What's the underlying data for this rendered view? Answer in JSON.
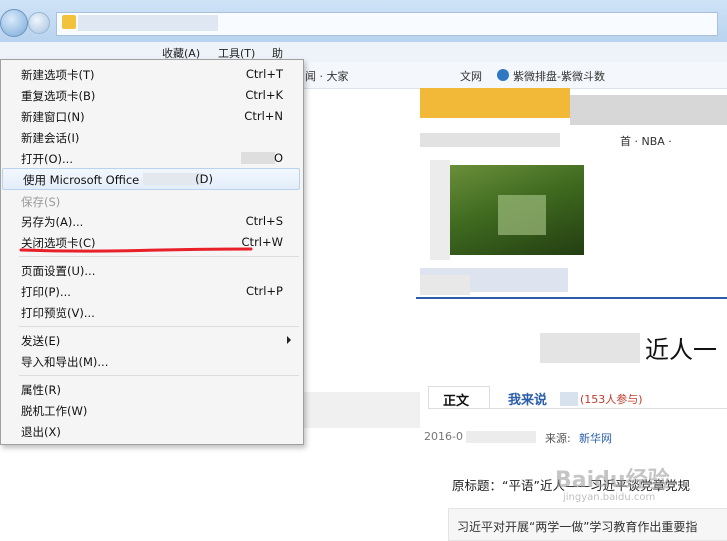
{
  "menubar": {
    "items": [
      "收藏(A)",
      "工具(T)",
      "助"
    ]
  },
  "favbar": {
    "items": [
      "闻 · 大家",
      "文网",
      "紫微排盘-紫微斗数"
    ]
  },
  "menu": {
    "items": [
      {
        "label": "新建选项卡(T)",
        "shortcut": "Ctrl+T"
      },
      {
        "label": "重复选项卡(B)",
        "shortcut": "Ctrl+K"
      },
      {
        "label": "新建窗口(N)",
        "shortcut": "Ctrl+N"
      },
      {
        "label": "新建会话(I)",
        "shortcut": ""
      },
      {
        "label": "打开(O)...",
        "shortcut": "O"
      },
      {
        "label": "使用 Microsoft Office",
        "shortcut": "(D)"
      },
      {
        "label": "保存(S)",
        "shortcut": ""
      },
      {
        "label": "另存为(A)...",
        "shortcut": "Ctrl+S"
      },
      {
        "label": "关闭选项卡(C)",
        "shortcut": "Ctrl+W"
      },
      {
        "label": "页面设置(U)...",
        "shortcut": ""
      },
      {
        "label": "打印(P)...",
        "shortcut": "Ctrl+P"
      },
      {
        "label": "打印预览(V)...",
        "shortcut": ""
      },
      {
        "label": "发送(E)",
        "shortcut": ""
      },
      {
        "label": "导入和导出(M)...",
        "shortcut": ""
      },
      {
        "label": "属性(R)",
        "shortcut": ""
      },
      {
        "label": "脱机工作(W)",
        "shortcut": ""
      },
      {
        "label": "退出(X)",
        "shortcut": ""
      }
    ]
  },
  "page": {
    "breadcrumb_tail": "首 · NBA ·",
    "headline_fragment": "近人一",
    "tab_main": "正文",
    "tab_comment": "我来说",
    "comment_count": "(153人参与)",
    "date_prefix": "2016-0",
    "source_label": "来源:",
    "source_name": "新华网",
    "orig_title": "原标题：“平语”近人——习近平谈党章党规",
    "body_fragment": "习近平对开展“两学一做”学习教育作出重要指"
  },
  "watermark": {
    "brand": "Baidu经验",
    "url": "jingyan.baidu.com"
  },
  "colors": {
    "menu_bg": "#f5f5f5",
    "highlight_border": "#b8d2ef",
    "annotation_red": "#e8202a",
    "link_blue": "#2b5eab"
  }
}
